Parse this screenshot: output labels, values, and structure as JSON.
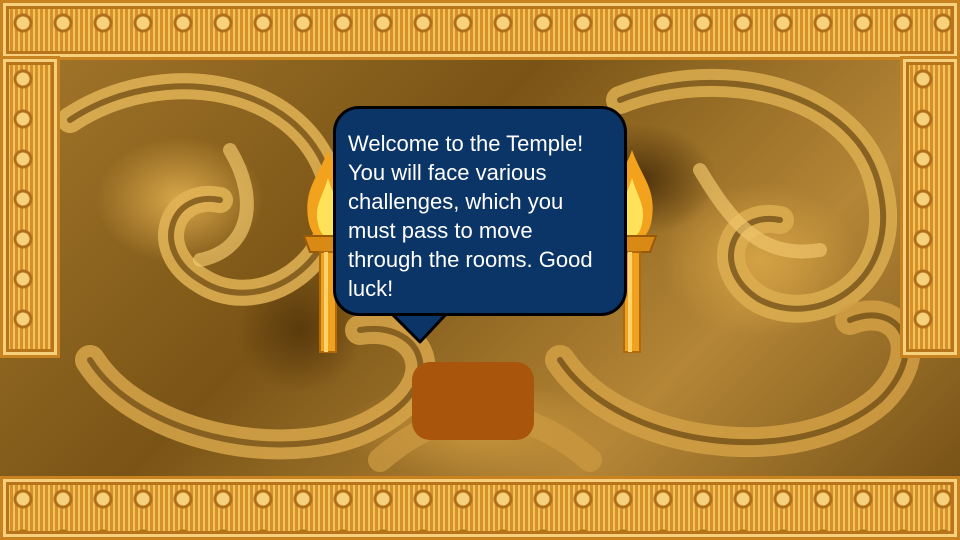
{
  "scene": {
    "message": "Welcome to the Temple! You will face various challenges, which you must pass to move through the rooms. Good luck!",
    "continue_label": ""
  },
  "colors": {
    "bubble_fill": "#0b3566",
    "bubble_text": "#ffffff",
    "button_fill": "#a9560c",
    "frame_gold": "#e8a73c"
  },
  "icons": {
    "left_torch": "torch-icon",
    "right_torch": "torch-icon"
  }
}
